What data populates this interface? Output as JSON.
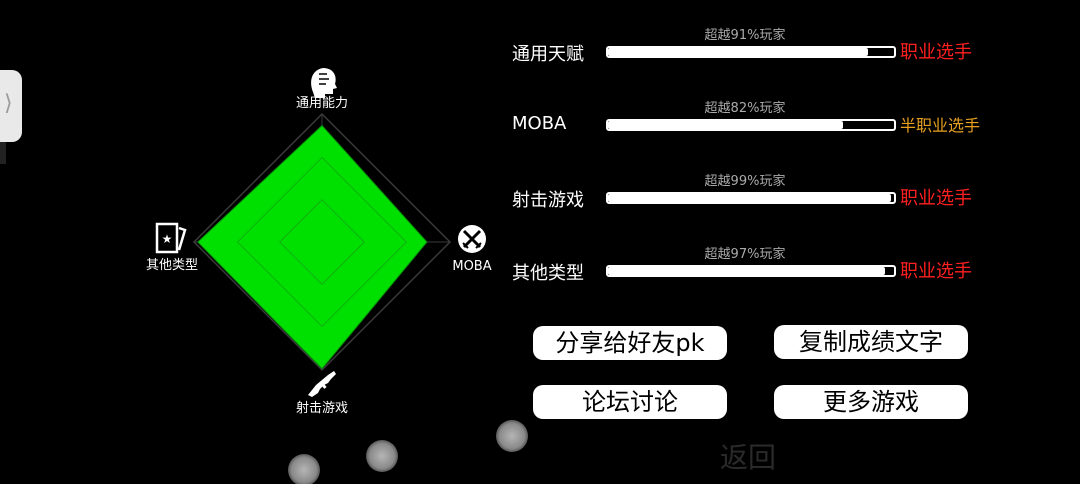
{
  "radar": {
    "axes": [
      {
        "label": "通用能力",
        "icon": "head-icon"
      },
      {
        "label": "MOBA",
        "icon": "swords-icon"
      },
      {
        "label": "射击游戏",
        "icon": "rifle-icon"
      },
      {
        "label": "其他类型",
        "icon": "card-icon"
      }
    ],
    "values": [
      0.91,
      0.82,
      0.99,
      0.97
    ],
    "fill_color": "#00e000",
    "grid_color": "#3a3a3a"
  },
  "rows": [
    {
      "label": "通用天赋",
      "percent_text": "超越91%玩家",
      "level": "职业选手",
      "level_color": "#ff2020",
      "fill": 0.91
    },
    {
      "label": "MOBA",
      "percent_text": "超越82%玩家",
      "level": "半职业选手",
      "level_color": "#e6a020",
      "fill": 0.82
    },
    {
      "label": "射击游戏",
      "percent_text": "超越99%玩家",
      "level": "职业选手",
      "level_color": "#ff2020",
      "fill": 0.99
    },
    {
      "label": "其他类型",
      "percent_text": "超越97%玩家",
      "level": "职业选手",
      "level_color": "#ff2020",
      "fill": 0.97
    }
  ],
  "buttons": {
    "share": "分享给好友pk",
    "copy": "复制成绩文字",
    "forum": "论坛讨论",
    "more": "更多游戏"
  },
  "back_label": "返回",
  "edge_handle_glyph": "⟩"
}
